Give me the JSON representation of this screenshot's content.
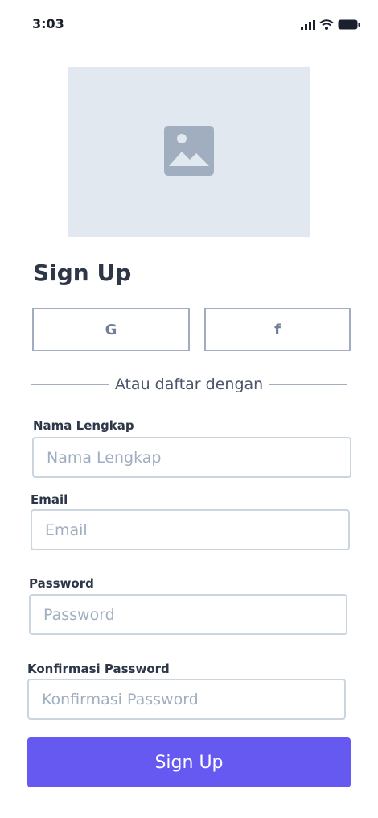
{
  "status_bar": {
    "time": "3:03",
    "icons": [
      "signal-icon",
      "wifi-icon",
      "battery-icon"
    ]
  },
  "hero": {
    "icon": "image-placeholder-icon"
  },
  "title": "Sign Up",
  "social": {
    "google_label": "G",
    "facebook_label": "f"
  },
  "divider_text": "Atau daftar dengan",
  "fields": {
    "name": {
      "label": "Nama Lengkap",
      "placeholder": "Nama Lengkap",
      "value": ""
    },
    "email": {
      "label": "Email",
      "placeholder": "Email",
      "value": ""
    },
    "password": {
      "label": "Password",
      "placeholder": "Password",
      "value": ""
    },
    "confirm": {
      "label": "Konfirmasi Password",
      "placeholder": "Konfirmasi Password",
      "value": ""
    }
  },
  "submit_label": "Sign Up",
  "colors": {
    "primary": "#6659f1",
    "placeholder_bg": "#e2e8f0",
    "border": "#cbd5e0",
    "text": "#2d3748"
  }
}
